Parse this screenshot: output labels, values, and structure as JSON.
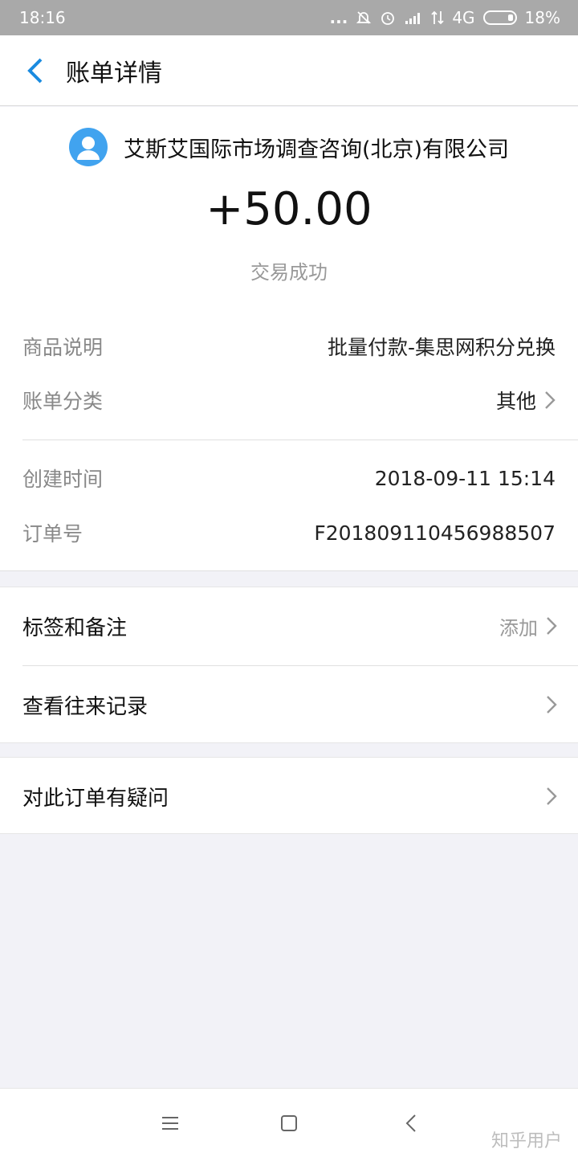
{
  "status_bar": {
    "time": "18:16",
    "dots": "...",
    "network": "4G",
    "battery": "18%",
    "icons": [
      "mute-bell-icon",
      "alarm-icon",
      "hd-signal-icon",
      "data-arrows-icon",
      "battery-icon"
    ]
  },
  "header": {
    "title": "账单详情",
    "back_icon": "chevron-left-icon",
    "accent_color": "#1a8be0"
  },
  "summary": {
    "merchant_name": "艾斯艾国际市场调查咨询(北京)有限公司",
    "avatar_icon": "user-avatar-icon",
    "amount": "+50.00",
    "status": "交易成功"
  },
  "info": {
    "product_label": "商品说明",
    "product_value": "批量付款-集思网积分兑换",
    "category_label": "账单分类",
    "category_value": "其他",
    "created_label": "创建时间",
    "created_value": "2018-09-11 15:14",
    "order_label": "订单号",
    "order_value": "F201809110456988507"
  },
  "actions": {
    "tags_label": "标签和备注",
    "tags_action": "添加",
    "history_label": "查看往来记录",
    "question_label": "对此订单有疑问"
  },
  "navbar": {
    "icons": [
      "menu-icon",
      "home-square-icon",
      "back-triangle-icon"
    ]
  },
  "watermark": "知乎用户"
}
